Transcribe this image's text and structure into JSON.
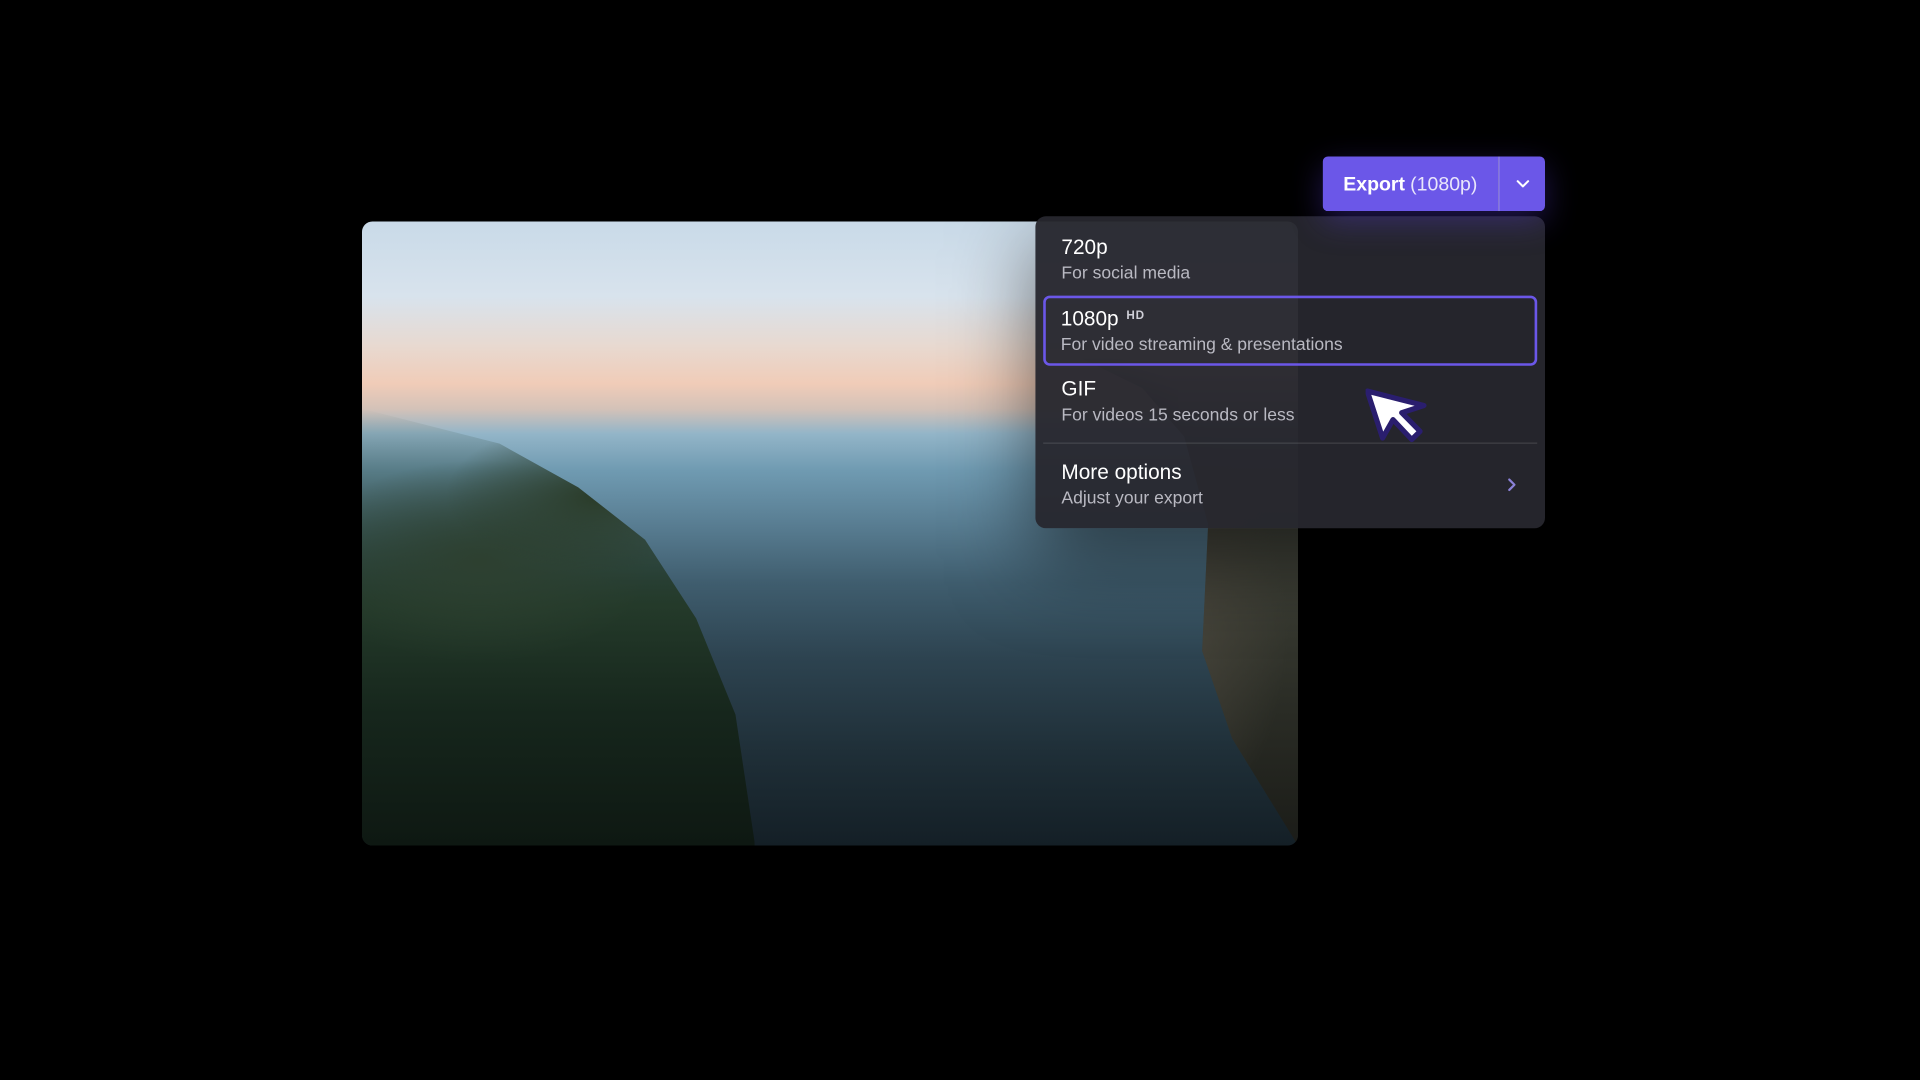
{
  "export_button": {
    "label": "Export",
    "current": "(1080p)"
  },
  "dropdown": {
    "items": [
      {
        "title": "720p",
        "subtitle": "For social media",
        "badge": "",
        "selected": false
      },
      {
        "title": "1080p",
        "subtitle": "For video streaming & presentations",
        "badge": "HD",
        "selected": true
      },
      {
        "title": "GIF",
        "subtitle": "For videos 15 seconds or less",
        "badge": "",
        "selected": false
      }
    ],
    "more": {
      "title": "More options",
      "subtitle": "Adjust your export"
    }
  }
}
